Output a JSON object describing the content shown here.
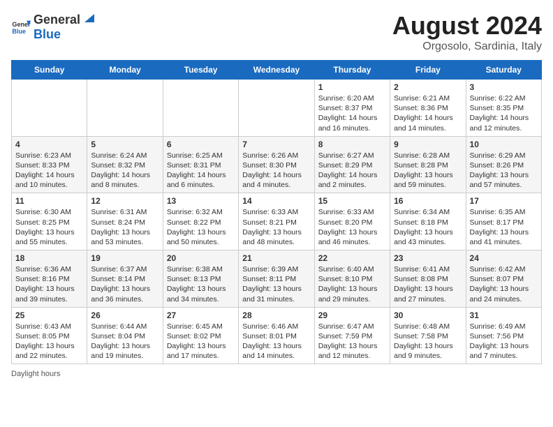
{
  "header": {
    "logo_general": "General",
    "logo_blue": "Blue",
    "title": "August 2024",
    "subtitle": "Orgosolo, Sardinia, Italy"
  },
  "days_of_week": [
    "Sunday",
    "Monday",
    "Tuesday",
    "Wednesday",
    "Thursday",
    "Friday",
    "Saturday"
  ],
  "weeks": [
    [
      {
        "day": "",
        "info": ""
      },
      {
        "day": "",
        "info": ""
      },
      {
        "day": "",
        "info": ""
      },
      {
        "day": "",
        "info": ""
      },
      {
        "day": "1",
        "info": "Sunrise: 6:20 AM\nSunset: 8:37 PM\nDaylight: 14 hours and 16 minutes."
      },
      {
        "day": "2",
        "info": "Sunrise: 6:21 AM\nSunset: 8:36 PM\nDaylight: 14 hours and 14 minutes."
      },
      {
        "day": "3",
        "info": "Sunrise: 6:22 AM\nSunset: 8:35 PM\nDaylight: 14 hours and 12 minutes."
      }
    ],
    [
      {
        "day": "4",
        "info": "Sunrise: 6:23 AM\nSunset: 8:33 PM\nDaylight: 14 hours and 10 minutes."
      },
      {
        "day": "5",
        "info": "Sunrise: 6:24 AM\nSunset: 8:32 PM\nDaylight: 14 hours and 8 minutes."
      },
      {
        "day": "6",
        "info": "Sunrise: 6:25 AM\nSunset: 8:31 PM\nDaylight: 14 hours and 6 minutes."
      },
      {
        "day": "7",
        "info": "Sunrise: 6:26 AM\nSunset: 8:30 PM\nDaylight: 14 hours and 4 minutes."
      },
      {
        "day": "8",
        "info": "Sunrise: 6:27 AM\nSunset: 8:29 PM\nDaylight: 14 hours and 2 minutes."
      },
      {
        "day": "9",
        "info": "Sunrise: 6:28 AM\nSunset: 8:28 PM\nDaylight: 13 hours and 59 minutes."
      },
      {
        "day": "10",
        "info": "Sunrise: 6:29 AM\nSunset: 8:26 PM\nDaylight: 13 hours and 57 minutes."
      }
    ],
    [
      {
        "day": "11",
        "info": "Sunrise: 6:30 AM\nSunset: 8:25 PM\nDaylight: 13 hours and 55 minutes."
      },
      {
        "day": "12",
        "info": "Sunrise: 6:31 AM\nSunset: 8:24 PM\nDaylight: 13 hours and 53 minutes."
      },
      {
        "day": "13",
        "info": "Sunrise: 6:32 AM\nSunset: 8:22 PM\nDaylight: 13 hours and 50 minutes."
      },
      {
        "day": "14",
        "info": "Sunrise: 6:33 AM\nSunset: 8:21 PM\nDaylight: 13 hours and 48 minutes."
      },
      {
        "day": "15",
        "info": "Sunrise: 6:33 AM\nSunset: 8:20 PM\nDaylight: 13 hours and 46 minutes."
      },
      {
        "day": "16",
        "info": "Sunrise: 6:34 AM\nSunset: 8:18 PM\nDaylight: 13 hours and 43 minutes."
      },
      {
        "day": "17",
        "info": "Sunrise: 6:35 AM\nSunset: 8:17 PM\nDaylight: 13 hours and 41 minutes."
      }
    ],
    [
      {
        "day": "18",
        "info": "Sunrise: 6:36 AM\nSunset: 8:16 PM\nDaylight: 13 hours and 39 minutes."
      },
      {
        "day": "19",
        "info": "Sunrise: 6:37 AM\nSunset: 8:14 PM\nDaylight: 13 hours and 36 minutes."
      },
      {
        "day": "20",
        "info": "Sunrise: 6:38 AM\nSunset: 8:13 PM\nDaylight: 13 hours and 34 minutes."
      },
      {
        "day": "21",
        "info": "Sunrise: 6:39 AM\nSunset: 8:11 PM\nDaylight: 13 hours and 31 minutes."
      },
      {
        "day": "22",
        "info": "Sunrise: 6:40 AM\nSunset: 8:10 PM\nDaylight: 13 hours and 29 minutes."
      },
      {
        "day": "23",
        "info": "Sunrise: 6:41 AM\nSunset: 8:08 PM\nDaylight: 13 hours and 27 minutes."
      },
      {
        "day": "24",
        "info": "Sunrise: 6:42 AM\nSunset: 8:07 PM\nDaylight: 13 hours and 24 minutes."
      }
    ],
    [
      {
        "day": "25",
        "info": "Sunrise: 6:43 AM\nSunset: 8:05 PM\nDaylight: 13 hours and 22 minutes."
      },
      {
        "day": "26",
        "info": "Sunrise: 6:44 AM\nSunset: 8:04 PM\nDaylight: 13 hours and 19 minutes."
      },
      {
        "day": "27",
        "info": "Sunrise: 6:45 AM\nSunset: 8:02 PM\nDaylight: 13 hours and 17 minutes."
      },
      {
        "day": "28",
        "info": "Sunrise: 6:46 AM\nSunset: 8:01 PM\nDaylight: 13 hours and 14 minutes."
      },
      {
        "day": "29",
        "info": "Sunrise: 6:47 AM\nSunset: 7:59 PM\nDaylight: 13 hours and 12 minutes."
      },
      {
        "day": "30",
        "info": "Sunrise: 6:48 AM\nSunset: 7:58 PM\nDaylight: 13 hours and 9 minutes."
      },
      {
        "day": "31",
        "info": "Sunrise: 6:49 AM\nSunset: 7:56 PM\nDaylight: 13 hours and 7 minutes."
      }
    ]
  ],
  "footer": {
    "note": "Daylight hours"
  }
}
